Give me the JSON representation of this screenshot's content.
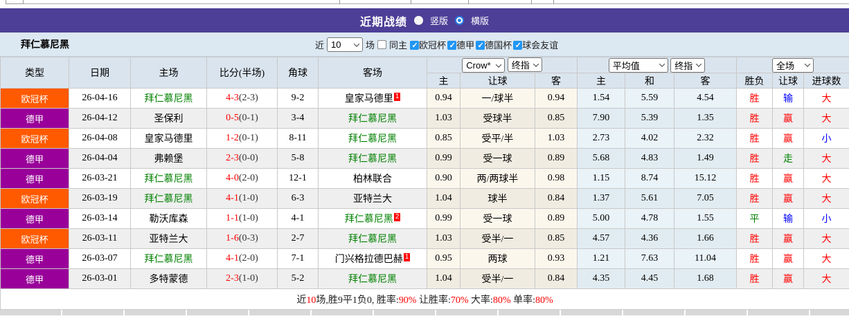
{
  "header": {
    "title": "近期战绩",
    "radio_vertical": "竖版",
    "radio_horizontal": "横版"
  },
  "filter": {
    "team": "拜仁慕尼黑",
    "near_label": "近",
    "matches_select": "10",
    "matches_label": "场",
    "same_home_label": "同主",
    "leagues": [
      "欧冠杯",
      "德甲",
      "德国杯",
      "球会友谊"
    ]
  },
  "colors": {
    "ucl": "#ff5a00",
    "bundesliga": "#990099",
    "accent_blue": "#2196f3",
    "bar_purple": "#4d3f97",
    "win_red": "#ff0000",
    "draw_green": "#008000",
    "lose_blue": "#0000ff"
  },
  "table": {
    "headers_left": [
      "类型",
      "日期",
      "主场",
      "比分(半场)",
      "角球",
      "客场"
    ],
    "odds_group": {
      "select1": "Crow*",
      "select2": "终指",
      "cols": [
        "主",
        "让球",
        "客"
      ]
    },
    "avg_group": {
      "select1": "平均值",
      "select2": "终指",
      "cols": [
        "主",
        "和",
        "客"
      ]
    },
    "result_group": {
      "select": "全场",
      "cols": [
        "胜负",
        "让球",
        "进球数"
      ]
    },
    "rows": [
      {
        "league": "欧冠杯",
        "league_type": "ucl",
        "date": "26-04-16",
        "home": "拜仁慕尼黑",
        "home_highlight": true,
        "score": "4-3",
        "half": "(2-3)",
        "corner": "9-2",
        "away": "皇家马德里",
        "away_highlight": false,
        "away_sup": "1",
        "odds": [
          "0.94",
          "一/球半",
          "0.94"
        ],
        "avg": [
          "1.54",
          "5.59",
          "4.54"
        ],
        "results": [
          [
            "胜",
            "r"
          ],
          [
            "输",
            "b"
          ],
          [
            "大",
            "r"
          ]
        ]
      },
      {
        "league": "德甲",
        "league_type": "bundesliga",
        "date": "26-04-12",
        "home": "圣保利",
        "home_highlight": false,
        "score": "0-5",
        "half": "(0-1)",
        "corner": "3-4",
        "away": "拜仁慕尼黑",
        "away_highlight": true,
        "odds": [
          "1.03",
          "受球半",
          "0.85"
        ],
        "avg": [
          "7.90",
          "5.39",
          "1.35"
        ],
        "results": [
          [
            "胜",
            "r"
          ],
          [
            "赢",
            "r"
          ],
          [
            "大",
            "r"
          ]
        ]
      },
      {
        "league": "欧冠杯",
        "league_type": "ucl",
        "date": "26-04-08",
        "home": "皇家马德里",
        "home_highlight": false,
        "score": "1-2",
        "half": "(0-1)",
        "corner": "8-11",
        "away": "拜仁慕尼黑",
        "away_highlight": true,
        "odds": [
          "0.85",
          "受平/半",
          "1.03"
        ],
        "avg": [
          "2.73",
          "4.02",
          "2.32"
        ],
        "results": [
          [
            "胜",
            "r"
          ],
          [
            "赢",
            "r"
          ],
          [
            "小",
            "b"
          ]
        ]
      },
      {
        "league": "德甲",
        "league_type": "bundesliga",
        "date": "26-04-04",
        "home": "弗赖堡",
        "home_highlight": false,
        "score": "2-3",
        "half": "(0-0)",
        "corner": "5-8",
        "away": "拜仁慕尼黑",
        "away_highlight": true,
        "odds": [
          "0.99",
          "受一球",
          "0.89"
        ],
        "avg": [
          "5.68",
          "4.83",
          "1.49"
        ],
        "results": [
          [
            "胜",
            "r"
          ],
          [
            "走",
            "g"
          ],
          [
            "大",
            "r"
          ]
        ]
      },
      {
        "league": "德甲",
        "league_type": "bundesliga",
        "date": "26-03-21",
        "home": "拜仁慕尼黑",
        "home_highlight": true,
        "score": "4-0",
        "half": "(2-0)",
        "corner": "12-1",
        "away": "柏林联合",
        "away_highlight": false,
        "odds": [
          "0.90",
          "两/两球半",
          "0.98"
        ],
        "avg": [
          "1.15",
          "8.74",
          "15.12"
        ],
        "results": [
          [
            "胜",
            "r"
          ],
          [
            "赢",
            "r"
          ],
          [
            "大",
            "r"
          ]
        ]
      },
      {
        "league": "欧冠杯",
        "league_type": "ucl",
        "date": "26-03-19",
        "home": "拜仁慕尼黑",
        "home_highlight": true,
        "score": "4-1",
        "half": "(1-0)",
        "corner": "6-3",
        "away": "亚特兰大",
        "away_highlight": false,
        "odds": [
          "1.04",
          "球半",
          "0.84"
        ],
        "avg": [
          "1.37",
          "5.61",
          "7.05"
        ],
        "results": [
          [
            "胜",
            "r"
          ],
          [
            "赢",
            "r"
          ],
          [
            "大",
            "r"
          ]
        ]
      },
      {
        "league": "德甲",
        "league_type": "bundesliga",
        "date": "26-03-14",
        "home": "勒沃库森",
        "home_highlight": false,
        "score": "1-1",
        "half": "(1-0)",
        "corner": "4-1",
        "away": "拜仁慕尼黑",
        "away_highlight": true,
        "away_sup": "2",
        "odds": [
          "0.99",
          "受一球",
          "0.89"
        ],
        "avg": [
          "5.00",
          "4.78",
          "1.55"
        ],
        "results": [
          [
            "平",
            "g"
          ],
          [
            "输",
            "b"
          ],
          [
            "小",
            "b"
          ]
        ]
      },
      {
        "league": "欧冠杯",
        "league_type": "ucl",
        "date": "26-03-11",
        "home": "亚特兰大",
        "home_highlight": false,
        "score": "1-6",
        "half": "(0-3)",
        "corner": "2-7",
        "away": "拜仁慕尼黑",
        "away_highlight": true,
        "odds": [
          "1.03",
          "受半/一",
          "0.85"
        ],
        "avg": [
          "4.57",
          "4.36",
          "1.66"
        ],
        "results": [
          [
            "胜",
            "r"
          ],
          [
            "赢",
            "r"
          ],
          [
            "大",
            "r"
          ]
        ]
      },
      {
        "league": "德甲",
        "league_type": "bundesliga",
        "date": "26-03-07",
        "home": "拜仁慕尼黑",
        "home_highlight": true,
        "score": "4-1",
        "half": "(2-0)",
        "corner": "7-1",
        "away": "门兴格拉德巴赫",
        "away_highlight": false,
        "away_sup": "1",
        "odds": [
          "0.95",
          "两球",
          "0.93"
        ],
        "avg": [
          "1.21",
          "7.63",
          "11.04"
        ],
        "results": [
          [
            "胜",
            "r"
          ],
          [
            "赢",
            "r"
          ],
          [
            "大",
            "r"
          ]
        ]
      },
      {
        "league": "德甲",
        "league_type": "bundesliga",
        "date": "26-03-01",
        "home": "多特蒙德",
        "home_highlight": false,
        "score": "2-3",
        "half": "(1-0)",
        "corner": "5-2",
        "away": "拜仁慕尼黑",
        "away_highlight": true,
        "odds": [
          "1.04",
          "受半/一",
          "0.84"
        ],
        "avg": [
          "4.35",
          "4.45",
          "1.68"
        ],
        "results": [
          [
            "胜",
            "r"
          ],
          [
            "赢",
            "r"
          ],
          [
            "大",
            "r"
          ]
        ]
      }
    ]
  },
  "summary": {
    "segments": [
      {
        "text": "近",
        "red": false
      },
      {
        "text": "10",
        "red": true
      },
      {
        "text": "场,胜9平1负0, 胜率:",
        "red": false
      },
      {
        "text": "90%",
        "red": true
      },
      {
        "text": " 让胜率:",
        "red": false
      },
      {
        "text": "70%",
        "red": true
      },
      {
        "text": " 大率:",
        "red": false
      },
      {
        "text": "80%",
        "red": true
      },
      {
        "text": " 单率:",
        "red": false
      },
      {
        "text": "80%",
        "red": true
      }
    ]
  }
}
